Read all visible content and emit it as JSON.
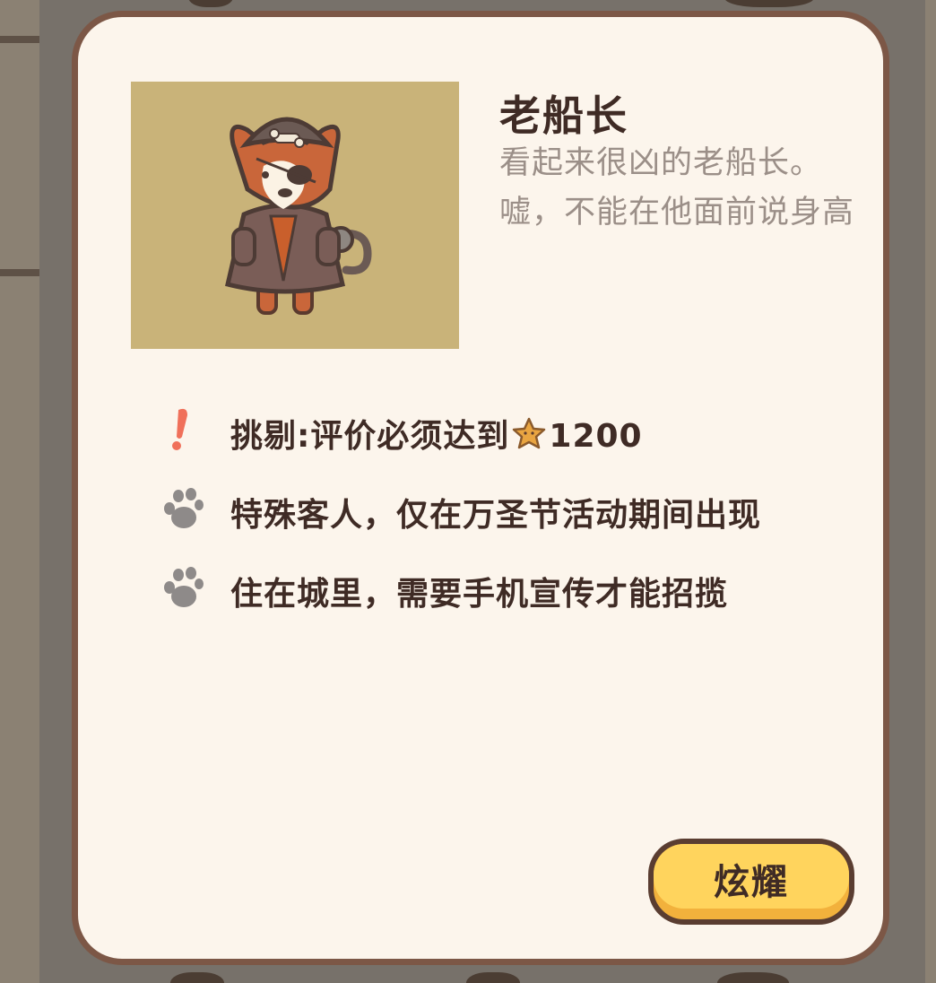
{
  "customer": {
    "name": "老船长",
    "description": "看起来很凶的老船长。嘘，不能在他面前说身高",
    "portrait_icon": "pirate-captain-dog-icon",
    "portrait_bg": "#c9b379"
  },
  "traits": [
    {
      "icon": "exclamation-icon",
      "label": "挑剔:评价必须达到",
      "value": "1200",
      "value_icon": "star-icon"
    },
    {
      "icon": "paw-icon",
      "label": "特殊客人，仅在万圣节活动期间出现"
    },
    {
      "icon": "paw-icon",
      "label": "住在城里，需要手机宣传才能招揽"
    }
  ],
  "actions": {
    "show_off_label": "炫耀"
  },
  "colors": {
    "card_bg": "#fcf5ec",
    "card_border": "#7c5746",
    "text_dark": "#3f2b25",
    "text_muted": "#9b8f88",
    "accent_red": "#f0705a",
    "button_yellow": "#ffd45d"
  }
}
